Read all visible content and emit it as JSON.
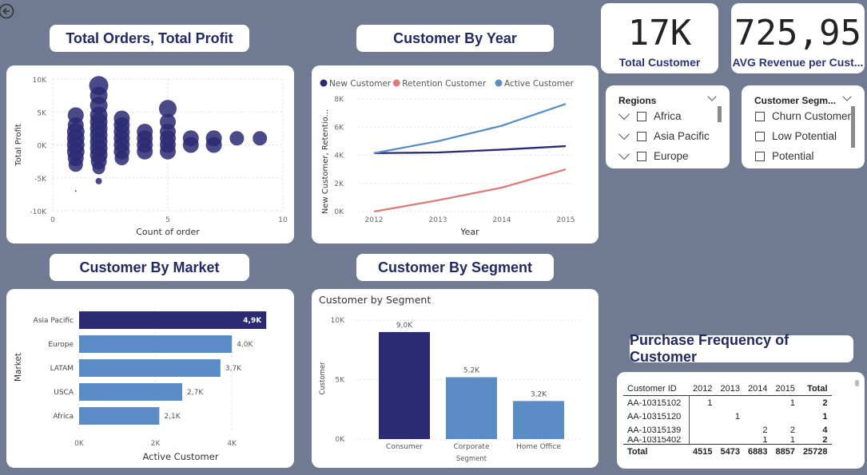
{
  "titles": {
    "orders_profit": "Total Orders, Total Profit",
    "customer_by_year": "Customer By Year",
    "customer_by_market": "Customer By Market",
    "customer_by_segment": "Customer By Segment",
    "purchase_frequency": "Purchase Frequency of Customer"
  },
  "kpis": [
    {
      "value": "17K",
      "label": "Total Customer"
    },
    {
      "value": "725,95",
      "label": "AVG Revenue per Cust..."
    }
  ],
  "slicers": {
    "regions": {
      "title": "Regions",
      "items": [
        "Africa",
        "Asia Pacific",
        "Europe"
      ]
    },
    "segment": {
      "title": "Customer Segm...",
      "items": [
        "Churn Customer",
        "Low Potential",
        "Potential"
      ]
    }
  },
  "table": {
    "headers": [
      "Customer ID",
      "2012",
      "2013",
      "2014",
      "2015",
      "Total"
    ],
    "rows": [
      [
        "AA-10315102",
        "1",
        "",
        "",
        "1",
        "2"
      ],
      [
        "AA-10315120",
        "",
        "1",
        "",
        "",
        "1"
      ],
      [
        "AA-10315139",
        "",
        "",
        "2",
        "2",
        "4"
      ],
      [
        "AA-10315402",
        "",
        "",
        "1",
        "1",
        "2"
      ]
    ],
    "total_row": [
      "Total",
      "4515",
      "5473",
      "6883",
      "8857",
      "25728"
    ]
  },
  "colors": {
    "background": "#707a93",
    "dark_navy": "#2b2a73",
    "steel_blue": "#5b8cc6",
    "salmon": "#dd7b7b",
    "title_text": "#222a63"
  },
  "chart_data": [
    {
      "type": "scatter",
      "title": "Total Orders, Total Profit",
      "xlabel": "Count of order",
      "ylabel": "Total Profit",
      "xlim": [
        0,
        10
      ],
      "ylim": [
        -10000,
        10000
      ],
      "x_ticks": [
        "0",
        "5",
        "10"
      ],
      "y_ticks": [
        "10K",
        "5K",
        "0K",
        "-5K",
        "-10K"
      ],
      "points": [
        {
          "x": 1,
          "y": -7000,
          "size": 1
        },
        {
          "x": 1,
          "y": -3000,
          "size": 9
        },
        {
          "x": 1,
          "y": -2000,
          "size": 10
        },
        {
          "x": 1,
          "y": -1000,
          "size": 11
        },
        {
          "x": 1,
          "y": 0,
          "size": 11
        },
        {
          "x": 1,
          "y": 1000,
          "size": 11
        },
        {
          "x": 1,
          "y": 2000,
          "size": 11
        },
        {
          "x": 1,
          "y": 3000,
          "size": 10
        },
        {
          "x": 1,
          "y": 4500,
          "size": 10
        },
        {
          "x": 2,
          "y": -5500,
          "size": 4
        },
        {
          "x": 2,
          "y": -3500,
          "size": 8
        },
        {
          "x": 2,
          "y": -2500,
          "size": 10
        },
        {
          "x": 2,
          "y": -1500,
          "size": 11
        },
        {
          "x": 2,
          "y": -500,
          "size": 11
        },
        {
          "x": 2,
          "y": 500,
          "size": 11
        },
        {
          "x": 2,
          "y": 1500,
          "size": 11
        },
        {
          "x": 2,
          "y": 2500,
          "size": 11
        },
        {
          "x": 2,
          "y": 3500,
          "size": 11
        },
        {
          "x": 2,
          "y": 4500,
          "size": 11
        },
        {
          "x": 2,
          "y": 6000,
          "size": 11
        },
        {
          "x": 2,
          "y": 7500,
          "size": 11
        },
        {
          "x": 2,
          "y": 9000,
          "size": 12
        },
        {
          "x": 3,
          "y": -2000,
          "size": 9
        },
        {
          "x": 3,
          "y": -1000,
          "size": 10
        },
        {
          "x": 3,
          "y": 0,
          "size": 10
        },
        {
          "x": 3,
          "y": 1000,
          "size": 10
        },
        {
          "x": 3,
          "y": 2000,
          "size": 10
        },
        {
          "x": 3,
          "y": 3000,
          "size": 10
        },
        {
          "x": 3,
          "y": 4000,
          "size": 10
        },
        {
          "x": 4,
          "y": -1000,
          "size": 10
        },
        {
          "x": 4,
          "y": 0,
          "size": 10
        },
        {
          "x": 4,
          "y": 1000,
          "size": 10
        },
        {
          "x": 4,
          "y": 2000,
          "size": 10
        },
        {
          "x": 5,
          "y": -1000,
          "size": 10
        },
        {
          "x": 5,
          "y": 0,
          "size": 10
        },
        {
          "x": 5,
          "y": 1000,
          "size": 10
        },
        {
          "x": 5,
          "y": 2000,
          "size": 10
        },
        {
          "x": 5,
          "y": 3500,
          "size": 10
        },
        {
          "x": 5,
          "y": 5500,
          "size": 11
        },
        {
          "x": 6,
          "y": 0,
          "size": 10
        },
        {
          "x": 6,
          "y": 1000,
          "size": 10
        },
        {
          "x": 7,
          "y": 0,
          "size": 10
        },
        {
          "x": 7,
          "y": 1000,
          "size": 10
        },
        {
          "x": 8,
          "y": 1000,
          "size": 9
        },
        {
          "x": 9,
          "y": 1000,
          "size": 9
        }
      ]
    },
    {
      "type": "line",
      "title": "Customer By Year",
      "xlabel": "Year",
      "ylabel": "New Customer, Retentio...",
      "x": [
        "2012",
        "2013",
        "2014",
        "2015"
      ],
      "ylim": [
        0,
        8000
      ],
      "y_ticks": [
        "8K",
        "6K",
        "4K",
        "2K",
        "0K"
      ],
      "legend_position": "top-left",
      "series": [
        {
          "name": "New Customer",
          "color": "#2b2a73",
          "values": [
            4150,
            4200,
            4400,
            4650
          ]
        },
        {
          "name": "Retention Customer",
          "color": "#dd7b7b",
          "values": [
            0,
            800,
            1700,
            3000
          ]
        },
        {
          "name": "Active Customer",
          "color": "#5b8cc6",
          "values": [
            4150,
            5000,
            6100,
            7650
          ]
        }
      ]
    },
    {
      "type": "bar",
      "orientation": "horizontal",
      "title": "Customer By Market",
      "xlabel": "Active Customer",
      "ylabel": "Market",
      "categories": [
        "Asia Pacific",
        "Europe",
        "LATAM",
        "USCA",
        "Africa"
      ],
      "values": [
        4900,
        4000,
        3700,
        2700,
        2100
      ],
      "data_labels": [
        "4,9K",
        "4,0K",
        "3,7K",
        "2,7K",
        "2,1K"
      ],
      "xlim": [
        0,
        5000
      ],
      "x_ticks": [
        "0K",
        "2K",
        "4K"
      ],
      "highlight_color": "#2b2a73",
      "bar_color": "#5b8cc6"
    },
    {
      "type": "bar",
      "title": "Customer by Segment",
      "xlabel": "Segment",
      "ylabel": "Customer",
      "categories": [
        "Consumer",
        "Corporate",
        "Home Office"
      ],
      "values": [
        9000,
        5200,
        3200
      ],
      "data_labels": [
        "9,0K",
        "5,2K",
        "3,2K"
      ],
      "ylim": [
        0,
        10000
      ],
      "y_ticks": [
        "10K",
        "5K",
        "0K"
      ],
      "colors": [
        "#2b2a73",
        "#5b8cc6",
        "#5b8cc6"
      ]
    }
  ]
}
